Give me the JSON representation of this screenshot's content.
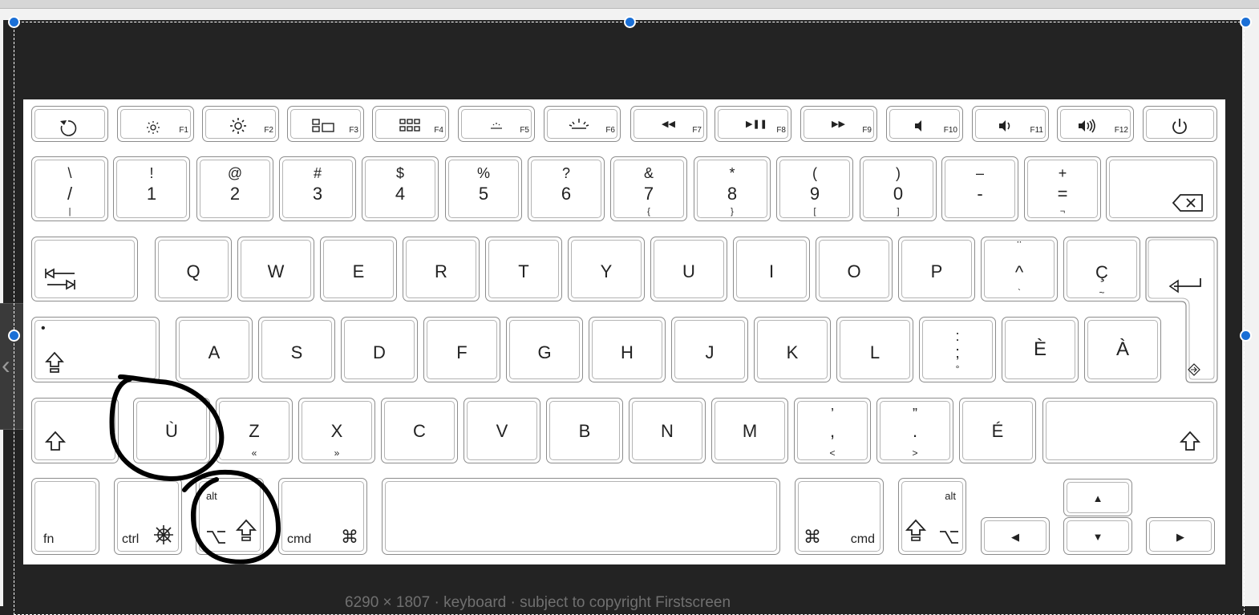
{
  "function_row": [
    {
      "name": "key-esc",
      "icon": "refresh-icon",
      "fn": ""
    },
    {
      "name": "key-f1",
      "icon": "brightness-down-icon",
      "fn": "F1"
    },
    {
      "name": "key-f2",
      "icon": "brightness-up-icon",
      "fn": "F2"
    },
    {
      "name": "key-f3",
      "icon": "mission-control-icon",
      "fn": "F3"
    },
    {
      "name": "key-f4",
      "icon": "launchpad-icon",
      "fn": "F4"
    },
    {
      "name": "key-f5",
      "icon": "keyboard-light-down-icon",
      "fn": "F5"
    },
    {
      "name": "key-f6",
      "icon": "keyboard-light-up-icon",
      "fn": "F6"
    },
    {
      "name": "key-f7",
      "icon": "rewind-icon",
      "fn": "F7",
      "glyph": "◀◀"
    },
    {
      "name": "key-f8",
      "icon": "play-pause-icon",
      "fn": "F8",
      "glyph": "▶❚❚"
    },
    {
      "name": "key-f9",
      "icon": "fast-forward-icon",
      "fn": "F9",
      "glyph": "▶▶"
    },
    {
      "name": "key-f10",
      "icon": "mute-icon",
      "fn": "F10"
    },
    {
      "name": "key-f11",
      "icon": "volume-down-icon",
      "fn": "F11"
    },
    {
      "name": "key-f12",
      "icon": "volume-up-icon",
      "fn": "F12"
    },
    {
      "name": "key-power",
      "icon": "power-icon",
      "fn": ""
    }
  ],
  "number_row": [
    {
      "top": "\\",
      "main": "/",
      "sub": "|"
    },
    {
      "top": "!",
      "main": "1",
      "sub": ""
    },
    {
      "top": "@",
      "main": "2",
      "sub": ""
    },
    {
      "top": "#",
      "main": "3",
      "sub": ""
    },
    {
      "top": "$",
      "main": "4",
      "sub": ""
    },
    {
      "top": "%",
      "main": "5",
      "sub": ""
    },
    {
      "top": "?",
      "main": "6",
      "sub": ""
    },
    {
      "top": "&",
      "main": "7",
      "sub": "{"
    },
    {
      "top": "*",
      "main": "8",
      "sub": "}"
    },
    {
      "top": "(",
      "main": "9",
      "sub": "["
    },
    {
      "top": ")",
      "main": "0",
      "sub": "]"
    },
    {
      "top": "–",
      "main": "-",
      "sub": ""
    },
    {
      "top": "+",
      "main": "=",
      "sub": "¬"
    }
  ],
  "backspace": {
    "icon": "backspace-icon"
  },
  "qwerty_row": {
    "tab_icon": "tab-icon",
    "letters": [
      "Q",
      "W",
      "E",
      "R",
      "T",
      "Y",
      "U",
      "I",
      "O",
      "P"
    ],
    "extra": [
      {
        "top": "¨",
        "main": "^",
        "sub": "`"
      },
      {
        "top": "",
        "main": "Ç",
        "sub": "~"
      }
    ],
    "return_icon": "return-icon"
  },
  "home_row": {
    "caps_dot": "•",
    "caps_icon": "caps-lock-icon",
    "letters": [
      "A",
      "S",
      "D",
      "F",
      "G",
      "H",
      "J",
      "K",
      "L"
    ],
    "semicolon": {
      "top": ":",
      "main": ";",
      "sub": "°"
    },
    "extra": [
      "È",
      "À"
    ],
    "enter_icon": "enter-icon"
  },
  "bottom_row": {
    "shift_icon": "shift-icon",
    "keys": [
      {
        "main": "Ù",
        "sub": ""
      },
      {
        "main": "Z",
        "sub": "«"
      },
      {
        "main": "X",
        "sub": "»"
      },
      {
        "main": "C",
        "sub": ""
      },
      {
        "main": "V",
        "sub": ""
      },
      {
        "main": "B",
        "sub": ""
      },
      {
        "main": "N",
        "sub": ""
      },
      {
        "main": "M",
        "sub": ""
      },
      {
        "top": "’",
        "main": ",",
        "sub": "<"
      },
      {
        "top": "”",
        "main": ".",
        "sub": ">"
      },
      {
        "main": "É",
        "sub": ""
      }
    ]
  },
  "modifier_row": {
    "fn": "fn",
    "ctrl": "ctrl",
    "ctrl_icon": "helm-icon",
    "alt": "alt",
    "option_glyph": "⌥",
    "cmd": "cmd",
    "cmd_glyph": "⌘",
    "arrow_up": "▲",
    "arrow_down": "▼",
    "arrow_left": "◀",
    "arrow_right": "▶"
  },
  "colors": {
    "background": "#232323",
    "keyboard": "#ffffff",
    "handle": "#1a6fd6",
    "ink": "#000000"
  },
  "footer_text": "6290 × 1807 · keyboard · subject to copyright Firstscreen"
}
